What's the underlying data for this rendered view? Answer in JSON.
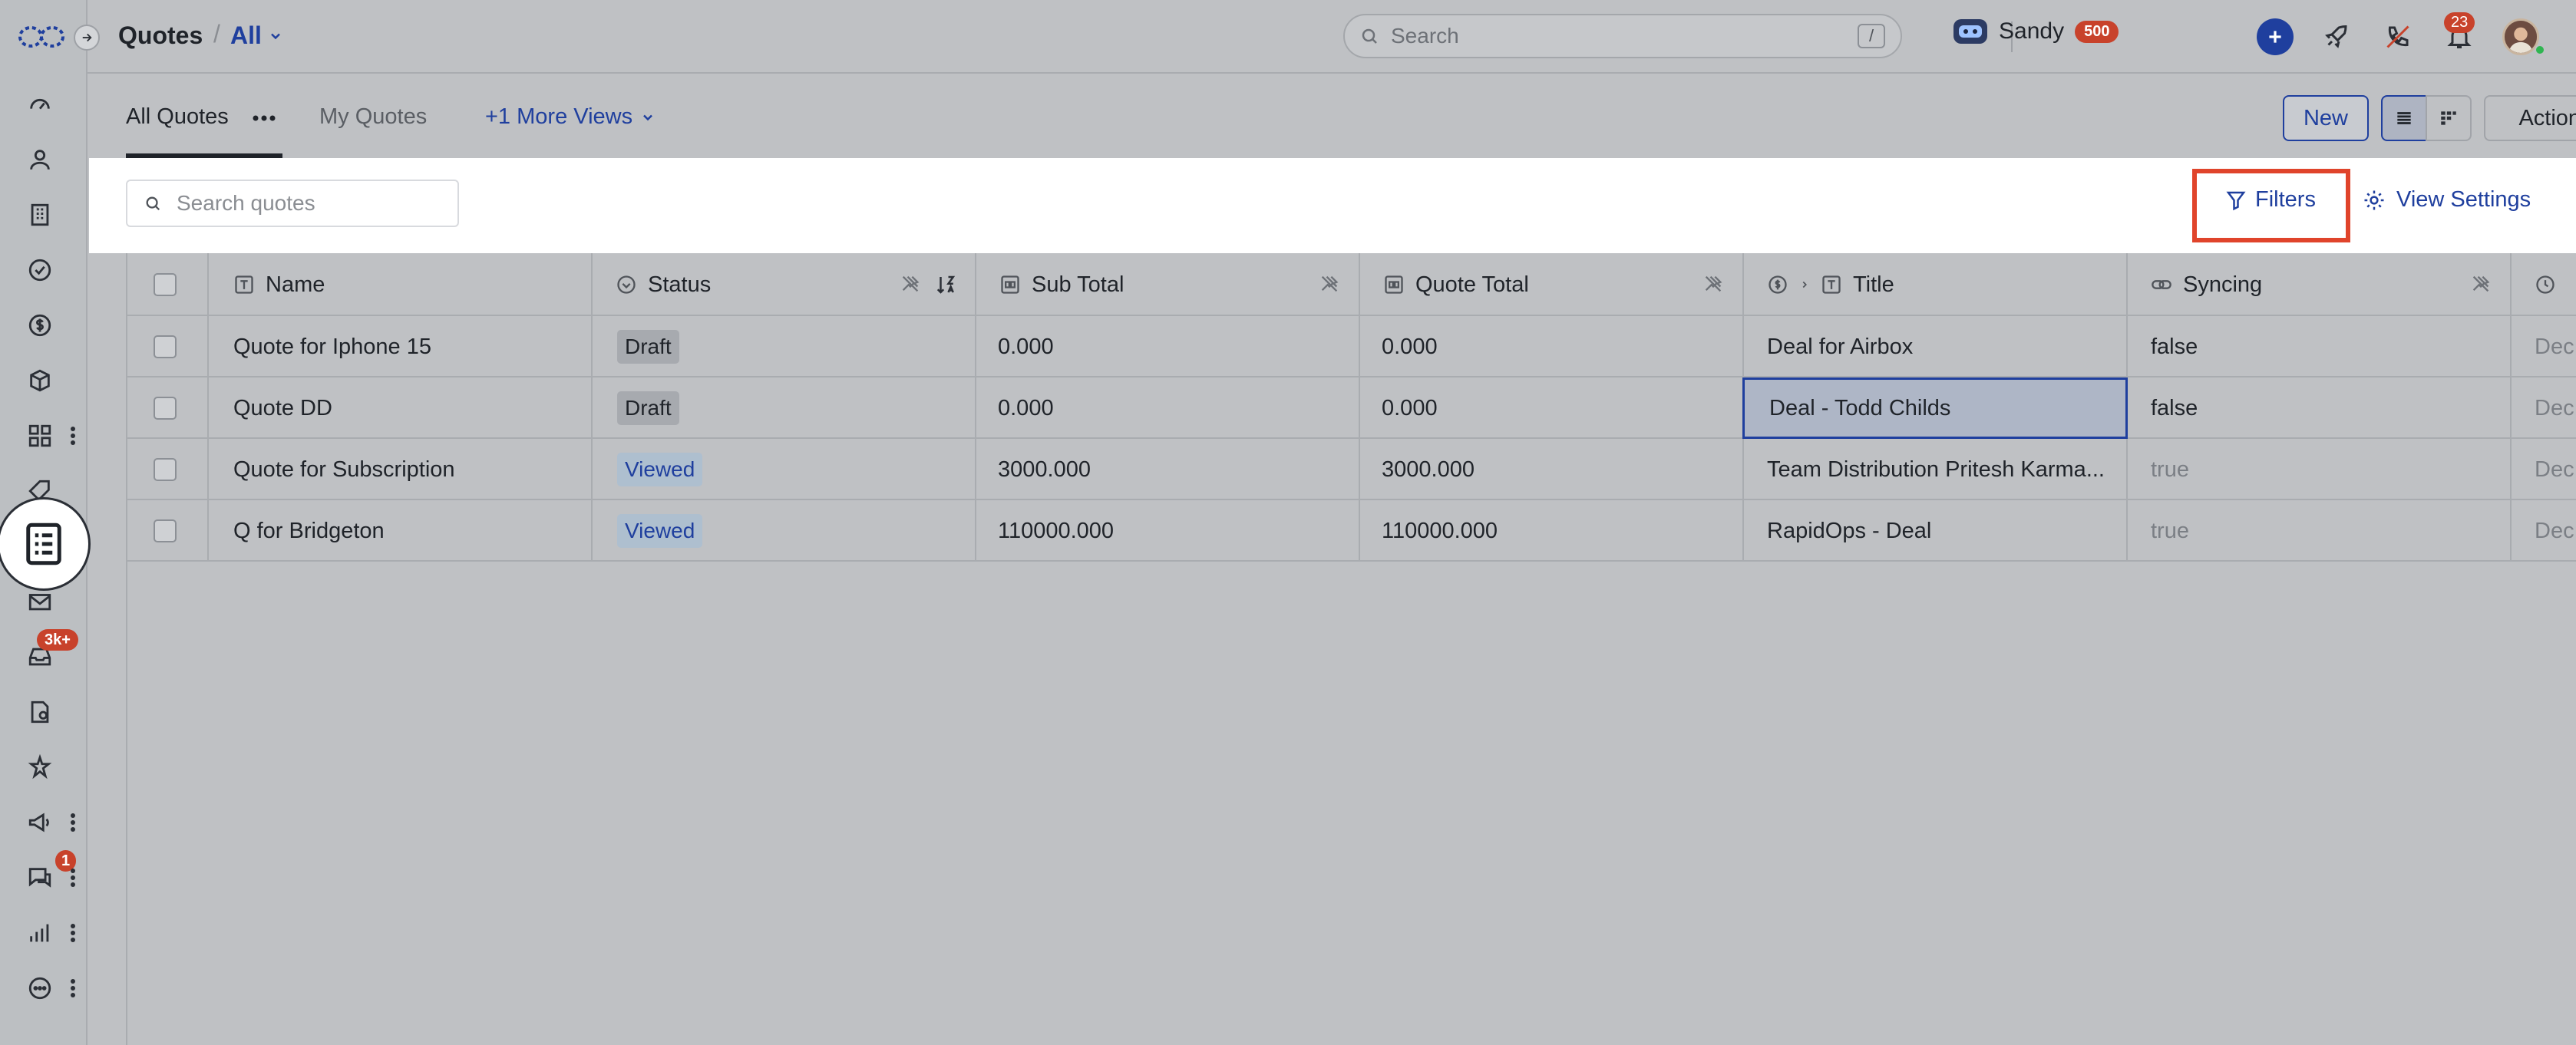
{
  "header": {
    "title": "Quotes",
    "separator": "/",
    "view": "All",
    "search_placeholder": "Search",
    "search_shortcut": "/",
    "user_name": "Sandy",
    "user_credits": "500",
    "notifications_count": "23"
  },
  "sidebar": {
    "inbox_badge": "3k+",
    "chat_badge": "1"
  },
  "views": {
    "tabs": [
      {
        "label": "All Quotes"
      },
      {
        "label": "My Quotes"
      }
    ],
    "more": "+1 More Views",
    "new_label": "New",
    "actions_label": "Actions"
  },
  "toolbar": {
    "search_placeholder": "Search quotes",
    "filters_label": "Filters",
    "view_settings_label": "View Settings"
  },
  "table": {
    "columns": [
      "Name",
      "Status",
      "Sub Total",
      "Quote Total",
      "Title",
      "Syncing"
    ],
    "rows": [
      {
        "name": "Quote for Iphone 15",
        "status": "Draft",
        "sub_total": "0.000",
        "quote_total": "0.000",
        "title": "Deal for Airbox",
        "syncing": "false",
        "last": "Dec"
      },
      {
        "name": "Quote DD",
        "status": "Draft",
        "sub_total": "0.000",
        "quote_total": "0.000",
        "title": "Deal - Todd Childs",
        "syncing": "false",
        "last": "Dec"
      },
      {
        "name": "Quote for Subscription",
        "status": "Viewed",
        "sub_total": "3000.000",
        "quote_total": "3000.000",
        "title": "Team Distribution Pritesh Karma...",
        "syncing": "true",
        "last": "Dec"
      },
      {
        "name": "Q for Bridgeton",
        "status": "Viewed",
        "sub_total": "110000.000",
        "quote_total": "110000.000",
        "title": "RapidOps - Deal",
        "syncing": "true",
        "last": "Dec"
      }
    ]
  },
  "colors": {
    "accent": "#1f3f9e",
    "badge": "#c8422b",
    "highlight_box": "#e0442b"
  }
}
